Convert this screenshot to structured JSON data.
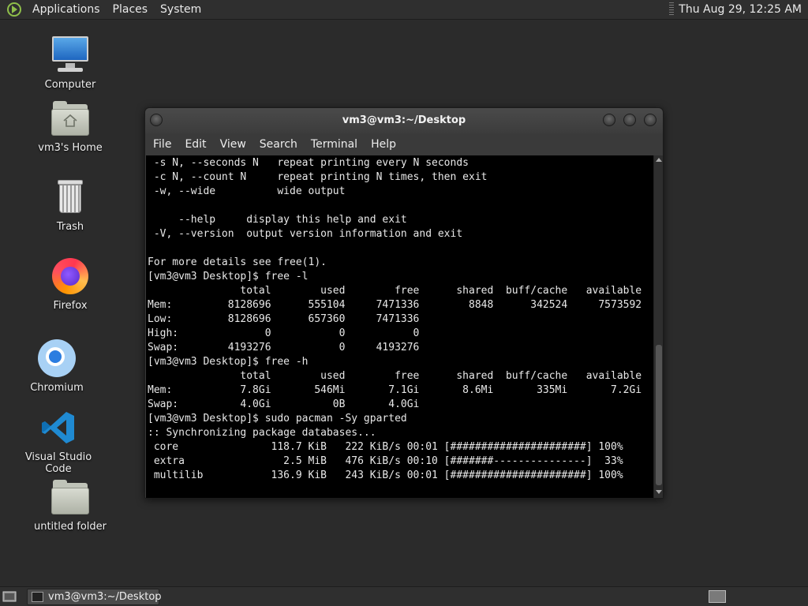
{
  "top_panel": {
    "menus": [
      "Applications",
      "Places",
      "System"
    ],
    "clock": "Thu Aug 29, 12:25 AM"
  },
  "desktop_icons": [
    {
      "label": "Computer",
      "icon": "computer-icon"
    },
    {
      "label": "vm3's Home",
      "icon": "home-folder-icon"
    },
    {
      "label": "Trash",
      "icon": "trash-icon"
    },
    {
      "label": "Firefox",
      "icon": "firefox-icon"
    },
    {
      "label": "Chromium",
      "icon": "chromium-icon"
    },
    {
      "label": "Visual Studio Code",
      "icon": "vscode-icon"
    },
    {
      "label": "untitled folder",
      "icon": "folder-icon"
    }
  ],
  "terminal": {
    "title": "vm3@vm3:~/Desktop",
    "menus": [
      "File",
      "Edit",
      "View",
      "Search",
      "Terminal",
      "Help"
    ],
    "lines": [
      " -s N, --seconds N   repeat printing every N seconds",
      " -c N, --count N     repeat printing N times, then exit",
      " -w, --wide          wide output",
      "",
      "     --help     display this help and exit",
      " -V, --version  output version information and exit",
      "",
      "For more details see free(1).",
      "[vm3@vm3 Desktop]$ free -l",
      "               total        used        free      shared  buff/cache   available",
      "Mem:         8128696      555104     7471336        8848      342524     7573592",
      "Low:         8128696      657360     7471336",
      "High:              0           0           0",
      "Swap:        4193276           0     4193276",
      "[vm3@vm3 Desktop]$ free -h",
      "               total        used        free      shared  buff/cache   available",
      "Mem:           7.8Gi       546Mi       7.1Gi       8.6Mi       335Mi       7.2Gi",
      "Swap:          4.0Gi          0B       4.0Gi",
      "[vm3@vm3 Desktop]$ sudo pacman -Sy gparted",
      ":: Synchronizing package databases...",
      " core               118.7 KiB   222 KiB/s 00:01 [######################] 100%",
      " extra                2.5 MiB   476 KiB/s 00:10 [#######---------------]  33%",
      " multilib           136.9 KiB   243 KiB/s 00:01 [######################] 100%"
    ]
  },
  "taskbar": {
    "task_label": "vm3@vm3:~/Desktop"
  }
}
